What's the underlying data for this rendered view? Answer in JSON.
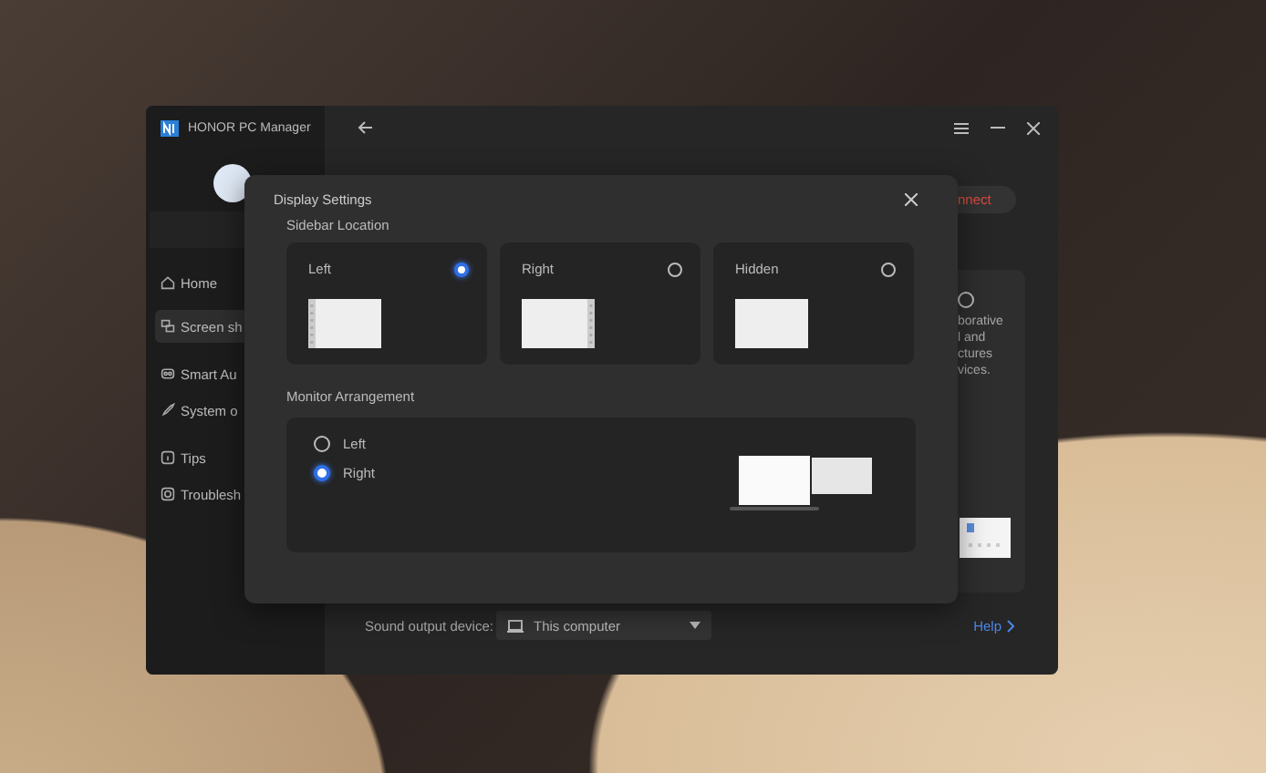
{
  "window": {
    "title": "HONOR PC Manager"
  },
  "sidebar": {
    "items": [
      {
        "label": "Home",
        "selected": false,
        "kind": "home"
      },
      {
        "label": "Screen sh",
        "selected": true,
        "kind": "screen"
      },
      {
        "label": "Smart Au",
        "selected": false,
        "kind": "audio"
      },
      {
        "label": "System o",
        "selected": false,
        "kind": "system"
      },
      {
        "label": "Tips",
        "selected": false,
        "kind": "tips"
      },
      {
        "label": "Troublesh",
        "selected": false,
        "kind": "trouble"
      }
    ]
  },
  "main": {
    "connect_button": "nnect",
    "card": {
      "lines": [
        "borative",
        "l and",
        "ctures",
        "vices."
      ],
      "selected": false
    },
    "sound_output": {
      "label": "Sound output device:",
      "value": "This computer"
    },
    "help_link": "Help"
  },
  "dialog": {
    "title": "Display Settings",
    "sidebar_location": {
      "heading": "Sidebar Location",
      "options": [
        {
          "label": "Left",
          "kind": "left",
          "selected": true
        },
        {
          "label": "Right",
          "kind": "right",
          "selected": false
        },
        {
          "label": "Hidden",
          "kind": "hidden",
          "selected": false
        }
      ]
    },
    "monitor_arrangement": {
      "heading": "Monitor Arrangement",
      "options": [
        {
          "label": "Left",
          "selected": false
        },
        {
          "label": "Right",
          "selected": true
        }
      ]
    }
  }
}
